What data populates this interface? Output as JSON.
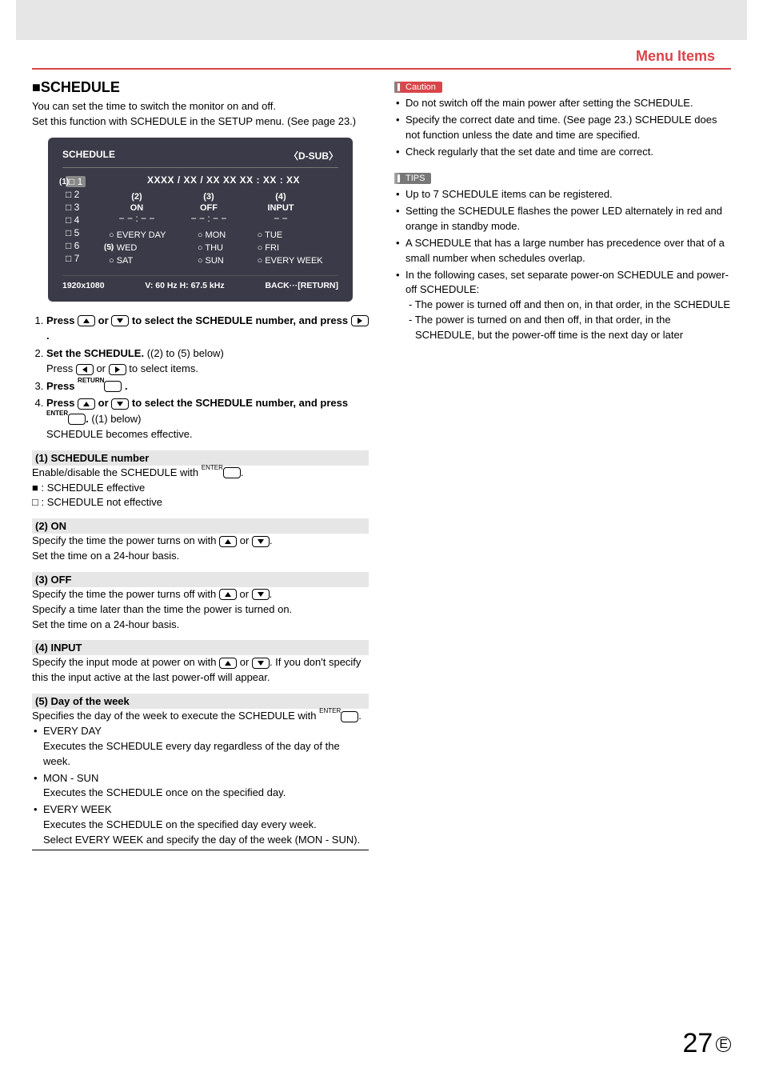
{
  "header": {
    "title": "Menu Items"
  },
  "schedule_section": {
    "heading_prefix": "■",
    "heading": "SCHEDULE",
    "intro1": "You can set the time to switch the monitor on and off.",
    "intro2": "Set this function with SCHEDULE in the SETUP menu. (See page 23.)"
  },
  "osd": {
    "title": "SCHEDULE",
    "source": "〈D-SUB〉",
    "date_line": "XXXX / XX / XX   XX   XX : XX : XX",
    "callouts": {
      "c1": "(1)",
      "c2": "(2)",
      "c3": "(3)",
      "c4": "(4)",
      "c5": "(5)"
    },
    "left_items": [
      "1",
      "2",
      "3",
      "4",
      "5",
      "6",
      "7"
    ],
    "cols": {
      "c2_label": "ON",
      "c3_label": "OFF",
      "c4_label": "INPUT",
      "c2_val": "− − : − −",
      "c3_val": "− − : − −",
      "c4_val": "− −"
    },
    "days": [
      "EVERY DAY",
      "MON",
      "TUE",
      "WED",
      "THU",
      "FRI",
      "SAT",
      "SUN",
      "EVERY WEEK"
    ],
    "footer_left": "1920x1080",
    "footer_mid": "V: 60 Hz   H: 67.5 kHz",
    "footer_right": "BACK···[RETURN]"
  },
  "steps": {
    "s1a": "Press ",
    "s1b": " or ",
    "s1c": " to select the SCHEDULE number, and press ",
    "s1d": ".",
    "s2a": "Set the SCHEDULE.",
    "s2b": " ((2) to (5) below)",
    "s2c": "Press ",
    "s2d": " or ",
    "s2e": " to select items.",
    "s3a": "Press ",
    "s3b": " .",
    "s3_sup": "RETURN",
    "s4a": "Press ",
    "s4b": " or ",
    "s4c": " to select the SCHEDULE number, and press ",
    "s4d": ".",
    "s4_sup": "ENTER",
    "s4e": " ((1) below)",
    "s4f": "SCHEDULE becomes effective."
  },
  "desc": {
    "h1": "(1) SCHEDULE number",
    "d1a": "Enable/disable the SCHEDULE with ",
    "d1a_sup": "ENTER",
    "d1a_end": ".",
    "d1b": ": SCHEDULE effective",
    "d1c": ": SCHEDULE not effective",
    "h2": "(2) ON",
    "d2a": "Specify the time the power turns on with ",
    "d2b": " or ",
    "d2c": ".",
    "d2d": "Set the time on a 24-hour basis.",
    "h3": "(3) OFF",
    "d3a": "Specify the time the power turns off with ",
    "d3b": " or ",
    "d3c": ".",
    "d3d": "Specify a time later than the time the power is turned on.",
    "d3e": "Set the time on a 24-hour basis.",
    "h4": "(4) INPUT",
    "d4a": "Specify the input mode at power on with ",
    "d4b": " or ",
    "d4c": ". If you don't specify this the input active at the last power-off will appear.",
    "h5": "(5) Day of the week",
    "d5a": "Specifies the day of the week to execute the SCHEDULE with ",
    "d5a_sup": "ENTER",
    "d5a_end": ".",
    "d5_items": [
      {
        "t": "EVERY DAY",
        "d": "Executes the SCHEDULE every day regardless of the day of the week."
      },
      {
        "t": "MON - SUN",
        "d": "Executes the SCHEDULE once on the specified day."
      },
      {
        "t": "EVERY WEEK",
        "d": "Executes the SCHEDULE on the specified day every week.\nSelect EVERY WEEK and specify the day of the week (MON - SUN)."
      }
    ]
  },
  "caution": {
    "label": "Caution",
    "items": [
      "Do not switch off the main power after setting the SCHEDULE.",
      "Specify the correct date and time. (See page 23.) SCHEDULE does not function unless the date and time are specified.",
      "Check regularly that the set date and time are correct."
    ]
  },
  "tips": {
    "label": "TIPS",
    "items": [
      "Up to 7 SCHEDULE items can be registered.",
      "Setting the SCHEDULE flashes the power LED alternately in red and orange in standby mode.",
      "A SCHEDULE that has a large number has precedence over that of a small number when schedules overlap.",
      "In the following cases, set separate power-on SCHEDULE and power-off SCHEDULE:"
    ],
    "sub": [
      "- The power is turned off and then on, in that order, in the SCHEDULE",
      "- The power is turned on and then off, in that order, in the SCHEDULE, but the power-off time is the next day or later"
    ]
  },
  "page_number": "27",
  "page_number_suffix": "E"
}
